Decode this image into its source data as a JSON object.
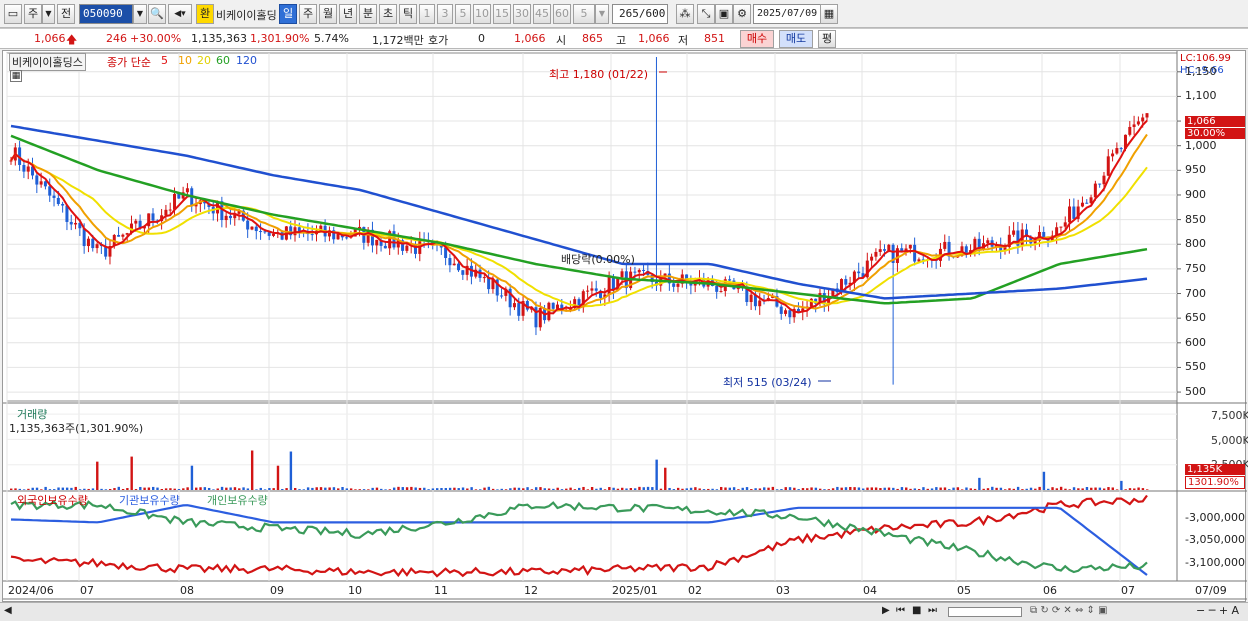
{
  "toolbar": {
    "period_label": "주",
    "period_alt": "전",
    "code": "050090",
    "stock_name": "비케이이홀딩",
    "hwan": "환",
    "periods": [
      "일",
      "주",
      "월",
      "년",
      "분",
      "초",
      "틱"
    ],
    "intervals": [
      "1",
      "3",
      "5",
      "10",
      "15",
      "30",
      "45",
      "60"
    ],
    "interval_sel": "5",
    "count": "265",
    "count_max": "/600",
    "date": "2025/07/09"
  },
  "info": {
    "price": "1,066",
    "change": "246",
    "change_pct": "+30.00%",
    "volume": "1,135,363",
    "vol_pct": "1,301.90%",
    "turnover": "5.74%",
    "amount": "1,172백만",
    "hoga_label": "호가",
    "hoga_value": "0",
    "hoga_price": "1,066",
    "open_label": "시",
    "open": "865",
    "high_label": "고",
    "high": "1,066",
    "low_label": "저",
    "low": "851",
    "buy": "매수",
    "sell": "매도",
    "eval": "평"
  },
  "price_panel": {
    "name": "비케이이홀딩스",
    "indicator": "종가 단순",
    "ma_labels": [
      "5",
      "10",
      "20",
      "60",
      "120"
    ],
    "lc": "LC:106.99",
    "hc": "HC:-9.66",
    "current_price": "1,066",
    "current_pct": "30.00%",
    "high_note": "최고 1,180 (01/22)",
    "low_note": "최저 515 (03/24)",
    "dividend_note": "배당락(0.00%)",
    "y_ticks": [
      "1,150",
      "1,100",
      "1,050",
      "1,000",
      "950",
      "900",
      "850",
      "800",
      "750",
      "700",
      "650",
      "600",
      "550",
      "500"
    ]
  },
  "volume_panel": {
    "title": "거래량",
    "value": "1,135,363주(1,301.90%)",
    "y_ticks": [
      "7,500K",
      "5,000K",
      "2,500K"
    ],
    "current": "1,135K",
    "current_pct": "1301.90%"
  },
  "holding_panel": {
    "series": [
      "외국인보유수량",
      "기관보유수량",
      "개인보유수량"
    ],
    "y_ticks": [
      "-3,000,000",
      "-3,050,000",
      "-3,100,000"
    ]
  },
  "x_axis": {
    "labels": [
      "2024/06",
      "07",
      "08",
      "09",
      "10",
      "11",
      "12",
      "2025/01",
      "02",
      "03",
      "04",
      "05",
      "06",
      "07"
    ],
    "end_label": "07/09"
  },
  "colors": {
    "up": "#d21414",
    "down": "#1f5fd6",
    "ma5": "#e01010",
    "ma10": "#f0a000",
    "ma20": "#f0e000",
    "ma60": "#23a023",
    "ma120": "#2050d0",
    "hold_foreign": "#d21414",
    "hold_inst": "#2c5ee0",
    "hold_indiv": "#3a9a5a"
  },
  "chart_data": {
    "type": "candlestick",
    "title": "비케이이홀딩스",
    "x": [
      "2024/06",
      "07",
      "08",
      "09",
      "10",
      "11",
      "12",
      "2025/01",
      "02",
      "03",
      "04",
      "05",
      "06",
      "07"
    ],
    "close_monthly_approx": [
      990,
      780,
      900,
      820,
      820,
      780,
      650,
      730,
      720,
      660,
      780,
      790,
      830,
      1066
    ],
    "ma120_monthly_approx": [
      1040,
      1010,
      980,
      940,
      910,
      860,
      810,
      760,
      760,
      720,
      690,
      700,
      710,
      730
    ],
    "ma60_monthly_approx": [
      1020,
      950,
      900,
      860,
      830,
      800,
      760,
      730,
      720,
      700,
      680,
      690,
      760,
      790
    ],
    "ylim": [
      500,
      1180
    ],
    "volume_peaks_k": [
      2800,
      3900,
      3400
    ],
    "holding_foreign_approx": [
      -3095000,
      -3100000,
      -3110000,
      -3110000,
      -3115000,
      -3115000,
      -3115000,
      -3110000,
      -3105000,
      -3060000,
      -3040000,
      -3030000,
      -3000000,
      -2990000
    ],
    "holding_inst_approx": [
      -3025000,
      -3030000,
      -3000000,
      -3030000,
      -3030000,
      -3030000,
      -3030000,
      -3030000,
      -3030000,
      -3005000,
      -3005000,
      -3005000,
      -3005000,
      -3120000
    ],
    "holding_indiv_approx": [
      -3000000,
      -3000000,
      -3030000,
      -3040000,
      -3050000,
      -3030000,
      -3000000,
      -3005000,
      -3010000,
      -3020000,
      -3050000,
      -3080000,
      -3110000,
      -3105000
    ]
  }
}
